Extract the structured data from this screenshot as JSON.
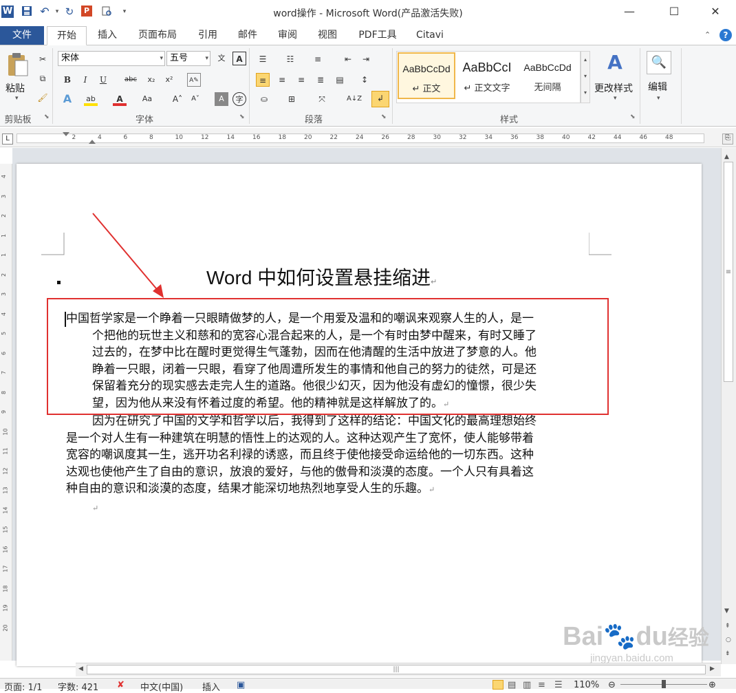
{
  "window": {
    "title": "word操作 - Microsoft Word(产品激活失败)",
    "min": "—",
    "max": "☐",
    "close": "✕"
  },
  "qat": {
    "word_logo": "W",
    "save": "💾",
    "undo": "↶",
    "redo": "↻",
    "pp": "P",
    "custom": "▾"
  },
  "tabs": {
    "file": "文件",
    "items": [
      "开始",
      "插入",
      "页面布局",
      "引用",
      "邮件",
      "审阅",
      "视图",
      "PDF工具",
      "Citavi"
    ],
    "active_index": 0
  },
  "ribbon": {
    "clipboard": {
      "paste": "粘贴",
      "label": "剪贴板"
    },
    "font": {
      "name": "宋体",
      "size": "五号",
      "label": "字体"
    },
    "paragraph": {
      "label": "段落"
    },
    "styles": {
      "label": "样式",
      "items": [
        {
          "sample": "AaBbCcDd",
          "name": "↵ 正文"
        },
        {
          "sample": "AaBbCcI",
          "name": "↵ 正文文字"
        },
        {
          "sample": "AaBbCcDd",
          "name": "无间隔"
        }
      ],
      "change": "更改样式"
    },
    "editing": {
      "label": "编辑"
    }
  },
  "ruler": {
    "ticks": [
      "2",
      "4",
      "6",
      "8",
      "10",
      "12",
      "14",
      "16",
      "18",
      "20",
      "22",
      "24",
      "26",
      "28",
      "30",
      "32",
      "34",
      "36",
      "38",
      "40",
      "42",
      "44",
      "46",
      "48"
    ],
    "vticks": [
      "4",
      "3",
      "2",
      "1",
      "1",
      "2",
      "3",
      "4",
      "5",
      "6",
      "7",
      "8",
      "9",
      "10",
      "11",
      "12",
      "13",
      "14",
      "15",
      "16",
      "17",
      "18",
      "19",
      "20"
    ]
  },
  "document": {
    "title": "Word 中如何设置悬挂缩进",
    "para1": {
      "first_line": "中国哲学家是一个睁着一只眼睛做梦的人，是一个用爱及温和的嘲讽来观察人生的人，是一",
      "lines": [
        "个把他的玩世主义和慈和的宽容心混合起来的人，是一个有时由梦中醒来，有时又睡了",
        "过去的，在梦中比在醒时更觉得生气蓬勃，因而在他清醒的生活中放进了梦意的人。他",
        "睁着一只眼，闭着一只眼，看穿了他周遭所发生的事情和他自己的努力的徒然，可是还",
        "保留着充分的现实感去走完人生的道路。他很少幻灭，因为他没有虚幻的憧憬，很少失",
        "望，因为他从来没有怀着过度的希望。他的精神就是这样解放了的。"
      ]
    },
    "para2": {
      "lines": [
        "因为在研究了中国的文学和哲学以后，我得到了这样的结论：中国文化的最高理想始终",
        "是一个对人生有一种建筑在明慧的悟性上的达观的人。这种达观产生了宽怀，使人能够带着",
        "宽容的嘲讽度其一生，逃开功名利禄的诱惑，而且终于使他接受命运给他的一切东西。这种",
        "达观也使他产生了自由的意识，放浪的爱好，与他的傲骨和淡漠的态度。一个人只有具着这",
        "种自由的意识和淡漠的态度，结果才能深切地热烈地享受人生的乐趣。"
      ]
    }
  },
  "status": {
    "page": "页面: 1/1",
    "words": "字数: 421",
    "lang": "中文(中国)",
    "mode": "插入",
    "zoom": "110%"
  },
  "watermark": {
    "brand": "Bai",
    "brand2": "du",
    "jingyan": "经验",
    "url": "jingyan.baidu.com"
  }
}
